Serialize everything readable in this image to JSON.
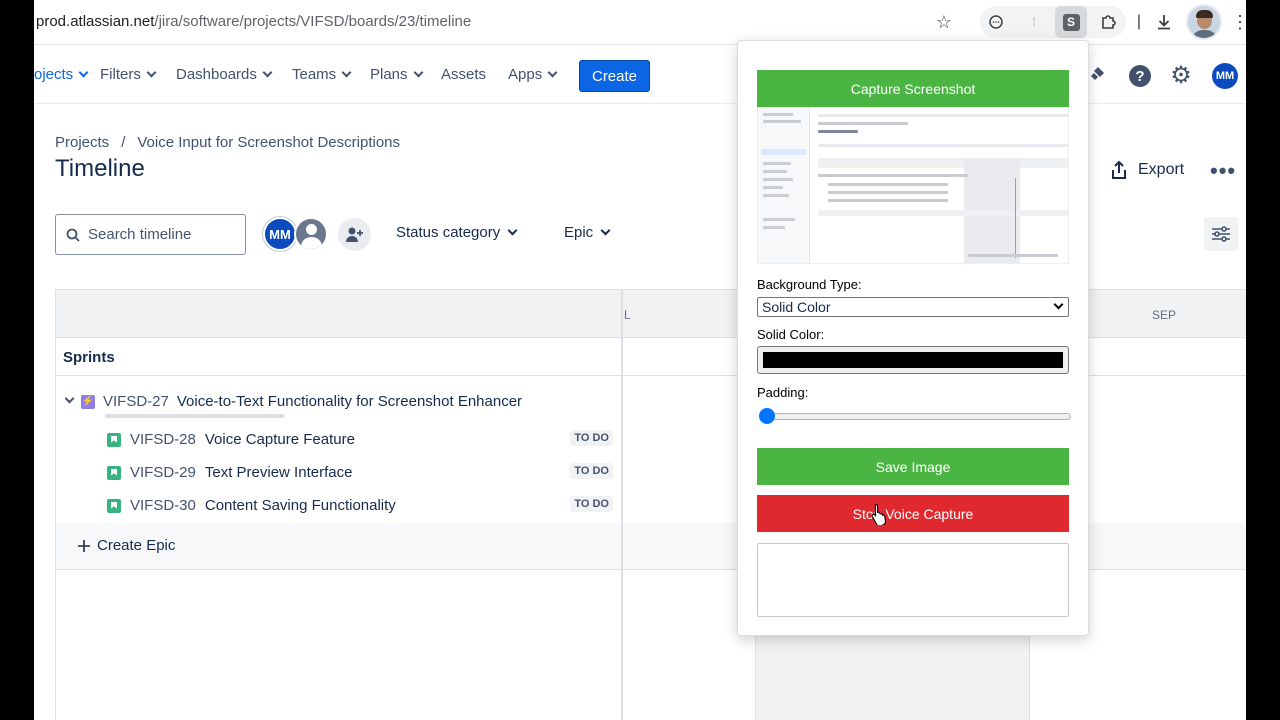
{
  "browser": {
    "url_host": "prod.atlassian.net",
    "url_path": "/jira/software/projects/VIFSD/boards/23/timeline",
    "extension_letter": "S"
  },
  "nav": {
    "items": [
      {
        "label": "ojects"
      },
      {
        "label": "Filters"
      },
      {
        "label": "Dashboards"
      },
      {
        "label": "Teams"
      },
      {
        "label": "Plans"
      },
      {
        "label": "Assets"
      },
      {
        "label": "Apps"
      }
    ],
    "create_label": "Create",
    "avatar_initials": "MM"
  },
  "breadcrumb": {
    "root": "Projects",
    "separator": "/",
    "project": "Voice Input for Screenshot Descriptions"
  },
  "page": {
    "title": "Timeline",
    "export_label": "Export",
    "more_label": "•••"
  },
  "toolbar": {
    "search_placeholder": "Search timeline",
    "avatar_initials": "MM",
    "status_filter": "Status category",
    "epic_filter": "Epic"
  },
  "timeline": {
    "months": [
      "L",
      "SEP"
    ],
    "sprints_label": "Sprints",
    "epic": {
      "key": "VIFSD-27",
      "summary": "Voice-to-Text Functionality for Screenshot Enhancer"
    },
    "issues": [
      {
        "key": "VIFSD-28",
        "summary": "Voice Capture Feature",
        "status": "TO DO"
      },
      {
        "key": "VIFSD-29",
        "summary": "Text Preview Interface",
        "status": "TO DO"
      },
      {
        "key": "VIFSD-30",
        "summary": "Content Saving Functionality",
        "status": "TO DO"
      }
    ],
    "create_epic_label": "Create Epic"
  },
  "extension_popup": {
    "capture_label": "Capture Screenshot",
    "background_type_label": "Background Type:",
    "background_type_value": "Solid Color",
    "solid_color_label": "Solid Color:",
    "solid_color_value": "#000000",
    "padding_label": "Padding:",
    "padding_value": 0,
    "save_label": "Save Image",
    "stop_label": "Stop Voice Capture",
    "transcript_text": ""
  },
  "colors": {
    "jira_blue": "#0c66e4",
    "green_button": "#4bb543",
    "red_button": "#e0292f",
    "today_line": "#f18d13"
  }
}
